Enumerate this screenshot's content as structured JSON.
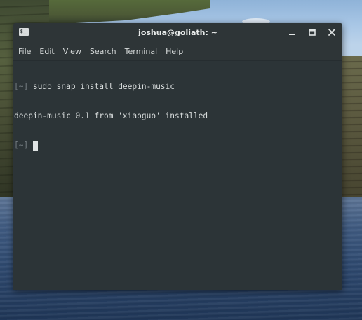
{
  "window": {
    "title": "joshua@goliath: ~",
    "icons": {
      "app": "terminal-icon",
      "minimize": "minimize-icon",
      "maximize": "maximize-icon",
      "close": "close-icon"
    },
    "app_icon_glyph": "$_"
  },
  "menu": {
    "items": [
      "File",
      "Edit",
      "View",
      "Search",
      "Terminal",
      "Help"
    ]
  },
  "terminal": {
    "lines": [
      {
        "prompt": "[~]",
        "text": " sudo snap install deepin-music"
      },
      {
        "prompt": "",
        "text": "deepin-music 0.1 from 'xiaoguo' installed"
      },
      {
        "prompt": "[~]",
        "text": " "
      }
    ]
  },
  "colors": {
    "window_bg": "#2c3437",
    "text": "#d9dddd",
    "prompt": "#747c80",
    "title_text": "#e9eceb"
  }
}
